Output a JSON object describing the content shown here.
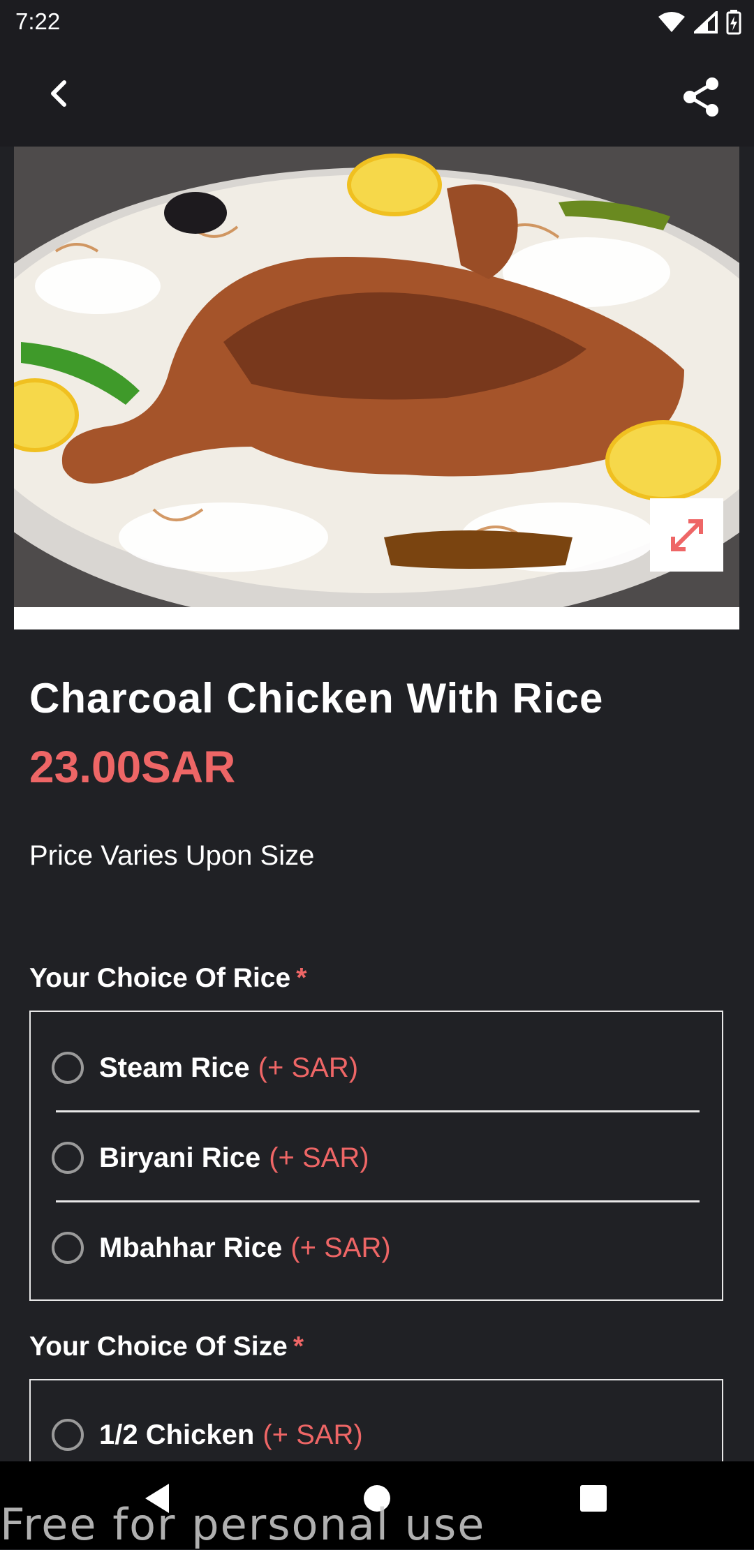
{
  "status_bar": {
    "time": "7:22"
  },
  "app_bar": {
    "back_icon": "chevron-left-icon",
    "share_icon": "share-icon"
  },
  "hero": {
    "image_alt": "Charcoal chicken on rice platter",
    "expand_icon": "expand-icon"
  },
  "product": {
    "title": "Charcoal Chicken With Rice",
    "price": "23.00SAR",
    "note": "Price Varies Upon Size"
  },
  "choices": [
    {
      "title": "Your Choice Of Rice",
      "required_mark": "*",
      "options": [
        {
          "label": "Steam Rice",
          "price": "(+ SAR)"
        },
        {
          "label": "Biryani Rice",
          "price": "(+ SAR)"
        },
        {
          "label": "Mbahhar Rice",
          "price": "(+ SAR)"
        }
      ]
    },
    {
      "title": "Your Choice Of Size",
      "required_mark": "*",
      "options": [
        {
          "label": "1/2 Chicken",
          "price": "(+ SAR)"
        }
      ]
    }
  ],
  "watermark": "Free for personal use",
  "colors": {
    "accent": "#ee6666",
    "background": "#202125",
    "bar": "#1c1c20"
  }
}
